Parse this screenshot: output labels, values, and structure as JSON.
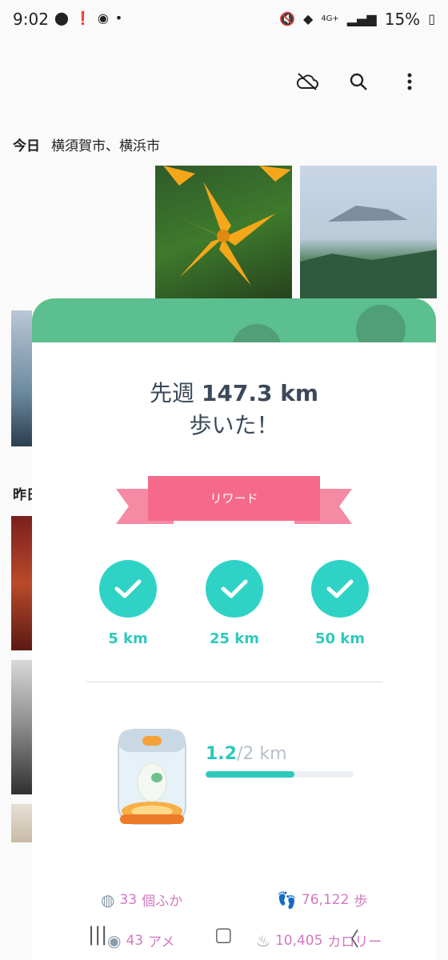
{
  "status_bar": {
    "time": "9:02",
    "battery": "15%",
    "network": "4G+"
  },
  "toolbar": {
    "icons": [
      "cloud-off-icon",
      "search-icon",
      "more-vert-icon"
    ]
  },
  "gallery": {
    "today_label": "今日",
    "today_location": "横須賀市、横浜市",
    "yesterday_label": "昨日"
  },
  "card": {
    "headline_prefix": "先週",
    "distance": "147.3 km",
    "headline_line2": "歩いた！",
    "ribbon_label": "リワード",
    "rewards": [
      {
        "label": "5 km",
        "achieved": true
      },
      {
        "label": "25 km",
        "achieved": true
      },
      {
        "label": "50 km",
        "achieved": true
      }
    ],
    "egg_progress": {
      "current": "1.2",
      "total": "/2 km",
      "fraction": 0.6
    },
    "stats": {
      "hatched_value": "33",
      "hatched_unit": "個ふか",
      "steps_value": "76,122",
      "steps_unit": "歩",
      "candy_value": "43",
      "candy_unit": "アメ",
      "calories_value": "10,405",
      "calories_unit": "カロリー"
    }
  },
  "colors": {
    "accent_teal": "#2ec9bd",
    "ribbon_pink": "#f56a8a",
    "header_green": "#5bbf8f",
    "stat_pink": "#d279c1"
  }
}
